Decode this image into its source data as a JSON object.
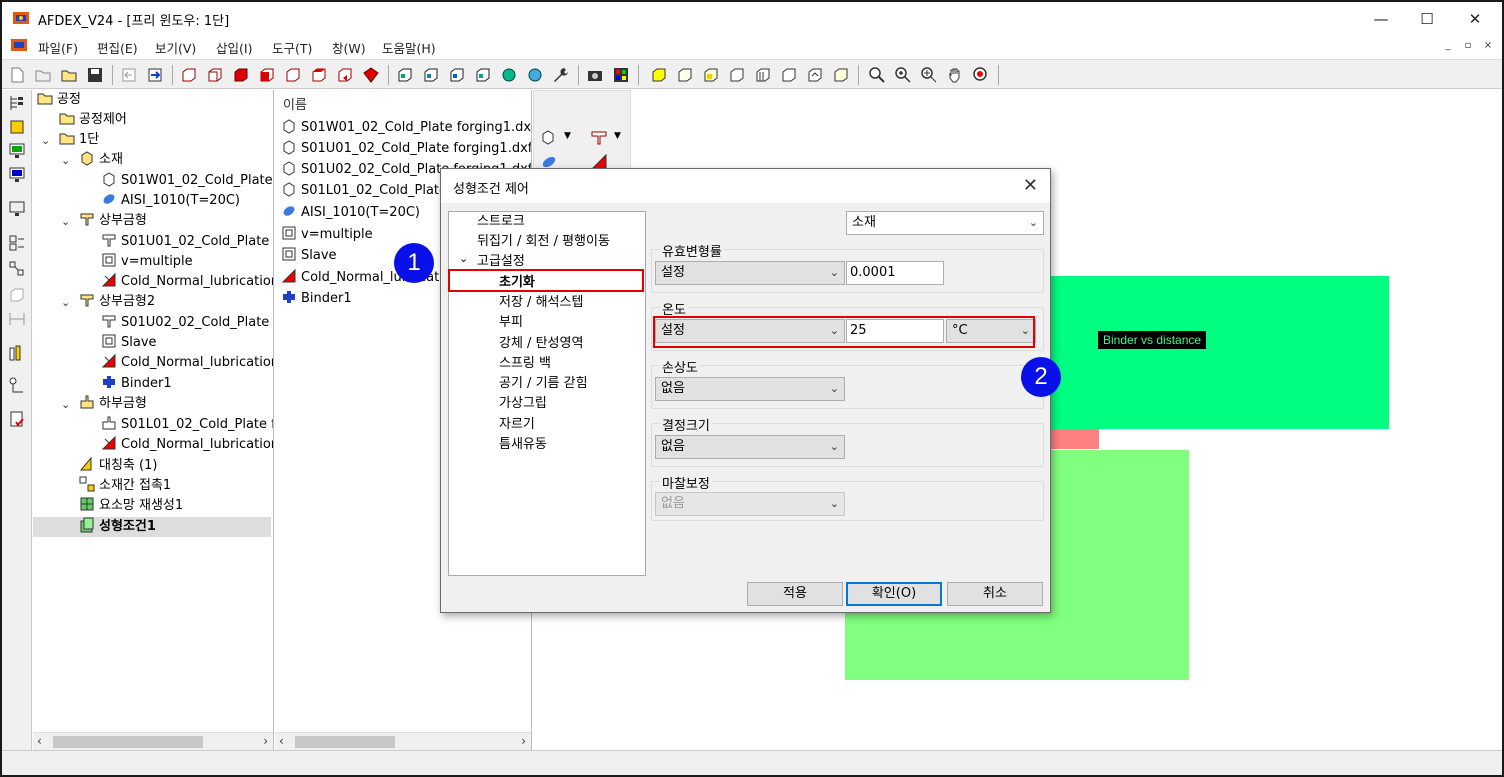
{
  "window": {
    "title": "AFDEX_V24 - [프리 윈도우: 1단]",
    "minimize": "—",
    "maximize": "☐",
    "close": "✕"
  },
  "menu": [
    "파일(F)",
    "편집(E)",
    "보기(V)",
    "삽입(I)",
    "도구(T)",
    "창(W)",
    "도움말(H)"
  ],
  "mdi": {
    "minimize": "_",
    "restore": "▫",
    "close": "×"
  },
  "tree": {
    "items": [
      {
        "label": "공정",
        "icon": "folder-open-icon"
      },
      {
        "label": "공정제어",
        "icon": "folder-icon"
      },
      {
        "label": "1단",
        "icon": "folder-open-icon"
      },
      {
        "label": "소재",
        "icon": "material-icon"
      },
      {
        "label": "S01W01_02_Cold_Plate",
        "icon": "part-icon"
      },
      {
        "label": "AISI_1010(T=20C)",
        "icon": "material-prop-icon"
      },
      {
        "label": "상부금형",
        "icon": "upper-die-icon"
      },
      {
        "label": "S01U01_02_Cold_Plate f",
        "icon": "die-part-icon"
      },
      {
        "label": "v=multiple",
        "icon": "press-icon"
      },
      {
        "label": "Cold_Normal_lubricatior",
        "icon": "lubrication-icon"
      },
      {
        "label": "상부금형2",
        "icon": "upper-die-icon"
      },
      {
        "label": "S01U02_02_Cold_Plate f",
        "icon": "die-part-icon"
      },
      {
        "label": "Slave",
        "icon": "press-icon"
      },
      {
        "label": "Cold_Normal_lubricatior",
        "icon": "lubrication-icon"
      },
      {
        "label": "Binder1",
        "icon": "binder-icon"
      },
      {
        "label": "하부금형",
        "icon": "lower-die-icon"
      },
      {
        "label": "S01L01_02_Cold_Plate f",
        "icon": "die-part-icon"
      },
      {
        "label": "Cold_Normal_lubricatior",
        "icon": "lubrication-icon"
      },
      {
        "label": "대칭축 (1)",
        "icon": "symmetry-icon"
      },
      {
        "label": "소재간 접촉1",
        "icon": "contact-icon"
      },
      {
        "label": "요소망 재생성1",
        "icon": "remesh-icon"
      },
      {
        "label": "성형조건1",
        "icon": "forming-condition-icon"
      }
    ]
  },
  "list": {
    "header": "이름",
    "items": [
      "S01W01_02_Cold_Plate forging1.dxf",
      "S01U01_02_Cold_Plate forging1.dxf",
      "S01U02_02_Cold_Plate forging1.dxf",
      "S01L01_02_Cold_Plate",
      "AISI_1010(T=20C)",
      "v=multiple",
      "Slave",
      "Cold_Normal_lubricatio",
      "Binder1"
    ]
  },
  "viewport": {
    "label": "Binder vs distance",
    "colors": {
      "upper": "#00ff80",
      "lower": "#80ff80",
      "pink": "#ff8080"
    }
  },
  "dialog": {
    "title": "성형조건 제어",
    "tree": [
      "스트로크",
      "뒤집기 / 회전 / 평행이동",
      "고급설정",
      "초기화",
      "저장 / 해석스텝",
      "부피",
      "강체 / 탄성영역",
      "스프링 백",
      "공기 / 기름 갇힘",
      "가상그립",
      "자르기",
      "틈새유동"
    ],
    "target_select": "소재",
    "groups": {
      "plastic_strain": {
        "label": "유효변형률",
        "select": "설정",
        "value": "0.0001"
      },
      "temperature": {
        "label": "온도",
        "select": "설정",
        "value": "25",
        "unit": "°C"
      },
      "damage": {
        "label": "손상도",
        "select": "없음"
      },
      "grain_size": {
        "label": "결정크기",
        "select": "없음"
      },
      "friction_correction": {
        "label": "마찰보정",
        "select": "없음"
      }
    },
    "buttons": {
      "apply": "적용",
      "ok": "확인(O)",
      "cancel": "취소"
    }
  },
  "callouts": {
    "one": "1",
    "two": "2"
  }
}
